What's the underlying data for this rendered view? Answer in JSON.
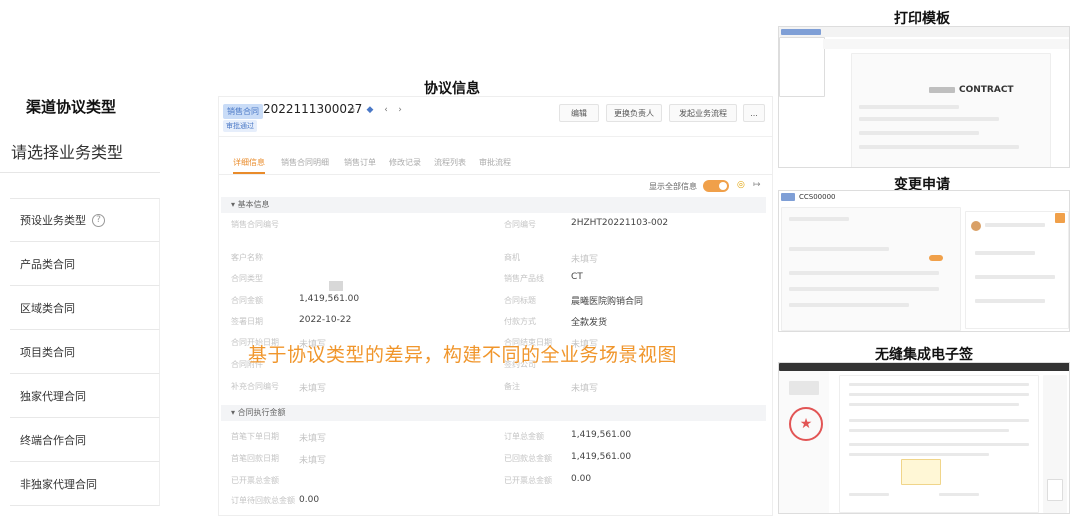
{
  "left": {
    "title": "渠道协议类型",
    "subtitle": "请选择业务类型",
    "items": [
      {
        "label": "预设业务类型",
        "help": "?"
      },
      {
        "label": "产品类合同"
      },
      {
        "label": "区域类合同"
      },
      {
        "label": "项目类合同"
      },
      {
        "label": "独家代理合同"
      },
      {
        "label": "终端合作合同"
      },
      {
        "label": "非独家代理合同"
      }
    ]
  },
  "center": {
    "heading": "协议信息",
    "tag": "销售合同",
    "contract_no": "2022111300027",
    "sub_tag": "审批通过",
    "buttons": [
      "编辑",
      "更换负责人",
      "发起业务流程",
      "..."
    ],
    "tabs": [
      "详细信息",
      "销售合同明细",
      "销售订单",
      "修改记录",
      "流程列表",
      "审批流程"
    ],
    "show_all_label": "显示全部信息",
    "sections": {
      "basic": "基本信息",
      "amount": "合同执行金额"
    },
    "fields": [
      {
        "label": "销售合同编号",
        "value": "",
        "label2": "合同编号",
        "value2": "2HZHT20221103-002"
      },
      {
        "label": "客户名称",
        "value": "",
        "label2": "商机",
        "value2": "未填写"
      },
      {
        "label": "合同类型",
        "value": "",
        "label2": "销售产品线",
        "value2": "CT"
      },
      {
        "label": "合同金额",
        "value": "1,419,561.00",
        "label2": "合同标题",
        "value2": "晨曦医院购销合同"
      },
      {
        "label": "签署日期",
        "value": "2022-10-22",
        "label2": "付款方式",
        "value2": "全款发货"
      },
      {
        "label": "合同开始日期",
        "value": "未填写",
        "label2": "合同结束日期",
        "value2": "未填写"
      },
      {
        "label": "合同附件",
        "value": "",
        "label2": "签约公司",
        "value2": ""
      },
      {
        "label": "补充合同编号",
        "value": "未填写",
        "label2": "备注",
        "value2": "未填写"
      }
    ],
    "amount_fields": [
      {
        "label": "首笔下单日期",
        "value": "未填写",
        "label2": "订单总金额",
        "value2": "1,419,561.00"
      },
      {
        "label": "首笔回款日期",
        "value": "未填写",
        "label2": "已回款总金额",
        "value2": "1,419,561.00"
      },
      {
        "label": "已开票总金额",
        "value": "",
        "label2": "已开票总金额",
        "value2": "0.00"
      },
      {
        "label": "订单待回款总金额",
        "value": "0.00"
      }
    ],
    "overlay_caption": "基于协议类型的差异，构建不同的全业务场景视图"
  },
  "right": {
    "print": {
      "heading": "打印模板",
      "doc_title": "CONTRACT"
    },
    "change": {
      "heading": "变更申请",
      "record_no": "CCS00000"
    },
    "esign": {
      "heading": "无缝集成电子签",
      "seal": "★"
    }
  }
}
